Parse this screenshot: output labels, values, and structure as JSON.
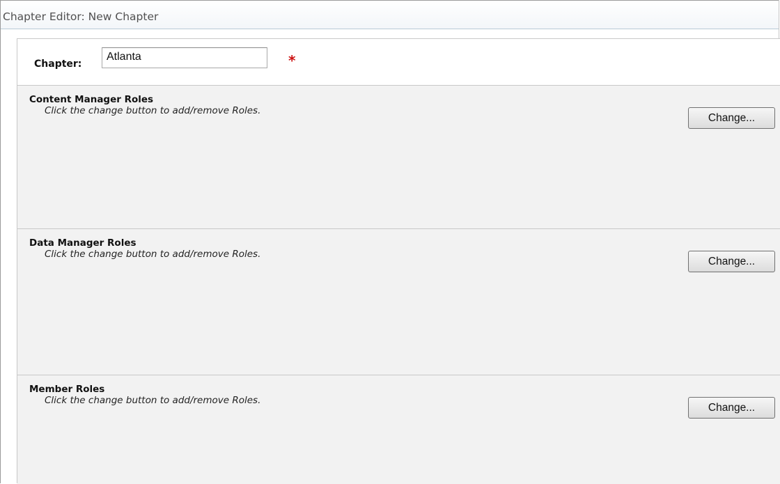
{
  "window": {
    "title": "Chapter Editor: New Chapter"
  },
  "chapter": {
    "label": "Chapter:",
    "value": "Atlanta",
    "required_marker": "*"
  },
  "sections": [
    {
      "title": "Content Manager Roles",
      "hint": "Click the change button to add/remove Roles.",
      "button_label": "Change..."
    },
    {
      "title": "Data Manager Roles",
      "hint": "Click the change button to add/remove Roles.",
      "button_label": "Change..."
    },
    {
      "title": "Member Roles",
      "hint": "Click the change button to add/remove Roles.",
      "button_label": "Change..."
    }
  ],
  "colors": {
    "required": "#cc1111",
    "section_background": "#f2f2f2",
    "border": "#c8c8c8"
  }
}
